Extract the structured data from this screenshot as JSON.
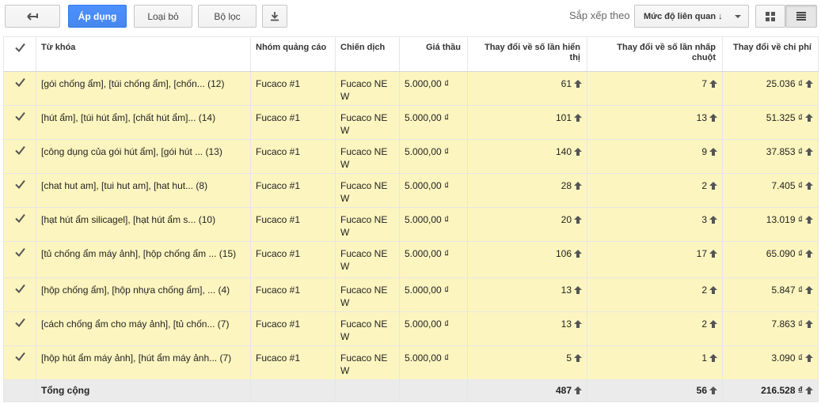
{
  "toolbar": {
    "back_icon": "back-arrow-icon",
    "apply_label": "Áp dụng",
    "reject_label": "Loại bỏ",
    "filter_label": "Bộ lọc",
    "download_icon": "download-icon",
    "sort_label": "Sắp xếp theo",
    "sort_value": "Mức độ liên quan ↓",
    "grid_view_icon": "grid-view-icon",
    "list_view_icon": "list-view-icon"
  },
  "table": {
    "headers": {
      "keyword": "Từ khóa",
      "ad_group": "Nhóm quảng cáo",
      "campaign": "Chiến dịch",
      "bid": "Giá thầu",
      "impressions": "Thay đổi về số lần hiển thị",
      "clicks": "Thay đổi về số lần nhấp chuột",
      "cost": "Thay đổi về chi phí"
    },
    "rows": [
      {
        "keyword": "[gói chống ẩm], [túi chống ẩm], [chốn... (12)",
        "ad_group": "Fucaco #1",
        "campaign": "Fucaco NE W",
        "bid": "5.000,00 ₫",
        "impressions": "61",
        "clicks": "7",
        "cost": "25.036 ₫"
      },
      {
        "keyword": "[hút ẩm], [túi hút ẩm], [chất hút ẩm]... (14)",
        "ad_group": "Fucaco #1",
        "campaign": "Fucaco NE W",
        "bid": "5.000,00 ₫",
        "impressions": "101",
        "clicks": "13",
        "cost": "51.325 ₫"
      },
      {
        "keyword": "[công dụng của gói hút ẩm], [gói hút ... (13)",
        "ad_group": "Fucaco #1",
        "campaign": "Fucaco NE W",
        "bid": "5.000,00 ₫",
        "impressions": "140",
        "clicks": "9",
        "cost": "37.853 ₫"
      },
      {
        "keyword": "[chat hut am], [tui hut am], [hat hut... (8)",
        "ad_group": "Fucaco #1",
        "campaign": "Fucaco NE W",
        "bid": "5.000,00 ₫",
        "impressions": "28",
        "clicks": "2",
        "cost": "7.405 ₫"
      },
      {
        "keyword": "[hạt hút ẩm silicagel], [hạt hút ẩm s... (10)",
        "ad_group": "Fucaco #1",
        "campaign": "Fucaco NE W",
        "bid": "5.000,00 ₫",
        "impressions": "20",
        "clicks": "3",
        "cost": "13.019 ₫"
      },
      {
        "keyword": "[tủ chống ẩm máy ảnh], [hộp chống ẩm ... (15)",
        "ad_group": "Fucaco #1",
        "campaign": "Fucaco NE W",
        "bid": "5.000,00 ₫",
        "impressions": "106",
        "clicks": "17",
        "cost": "65.090 ₫"
      },
      {
        "keyword": "[hộp chống ẩm], [hộp nhựa chống ẩm], ... (4)",
        "ad_group": "Fucaco #1",
        "campaign": "Fucaco NE W",
        "bid": "5.000,00 ₫",
        "impressions": "13",
        "clicks": "2",
        "cost": "5.847 ₫"
      },
      {
        "keyword": "[cách chống ẩm cho máy ảnh], [tủ chốn... (7)",
        "ad_group": "Fucaco #1",
        "campaign": "Fucaco NE W",
        "bid": "5.000,00 ₫",
        "impressions": "13",
        "clicks": "2",
        "cost": "7.863 ₫"
      },
      {
        "keyword": "[hộp hút ẩm máy ảnh], [hút ẩm máy ảnh... (7)",
        "ad_group": "Fucaco #1",
        "campaign": "Fucaco NE W",
        "bid": "5.000,00 ₫",
        "impressions": "5",
        "clicks": "1",
        "cost": "3.090 ₫"
      }
    ],
    "total": {
      "label": "Tổng cộng",
      "impressions": "487",
      "clicks": "56",
      "cost": "216.528 ₫"
    }
  },
  "colors": {
    "primary": "#4d90fe",
    "row_highlight": "#fdf5bf",
    "total_row": "#ebebeb",
    "arrow": "#555555"
  }
}
